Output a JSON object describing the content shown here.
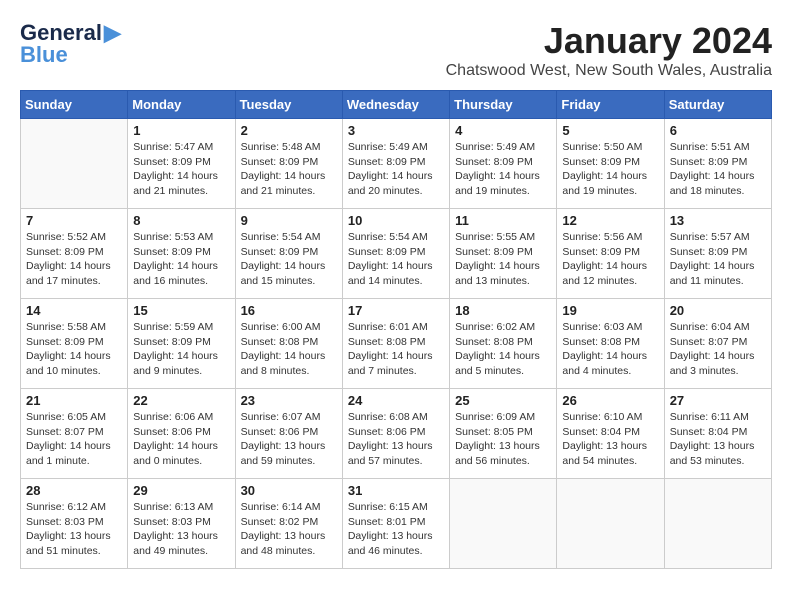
{
  "logo": {
    "general": "General",
    "blue": "Blue",
    "bird_unicode": "🐦"
  },
  "title": "January 2024",
  "subtitle": "Chatswood West, New South Wales, Australia",
  "days_header": [
    "Sunday",
    "Monday",
    "Tuesday",
    "Wednesday",
    "Thursday",
    "Friday",
    "Saturday"
  ],
  "weeks": [
    [
      {
        "num": "",
        "info": ""
      },
      {
        "num": "1",
        "info": "Sunrise: 5:47 AM\nSunset: 8:09 PM\nDaylight: 14 hours\nand 21 minutes."
      },
      {
        "num": "2",
        "info": "Sunrise: 5:48 AM\nSunset: 8:09 PM\nDaylight: 14 hours\nand 21 minutes."
      },
      {
        "num": "3",
        "info": "Sunrise: 5:49 AM\nSunset: 8:09 PM\nDaylight: 14 hours\nand 20 minutes."
      },
      {
        "num": "4",
        "info": "Sunrise: 5:49 AM\nSunset: 8:09 PM\nDaylight: 14 hours\nand 19 minutes."
      },
      {
        "num": "5",
        "info": "Sunrise: 5:50 AM\nSunset: 8:09 PM\nDaylight: 14 hours\nand 19 minutes."
      },
      {
        "num": "6",
        "info": "Sunrise: 5:51 AM\nSunset: 8:09 PM\nDaylight: 14 hours\nand 18 minutes."
      }
    ],
    [
      {
        "num": "7",
        "info": "Sunrise: 5:52 AM\nSunset: 8:09 PM\nDaylight: 14 hours\nand 17 minutes."
      },
      {
        "num": "8",
        "info": "Sunrise: 5:53 AM\nSunset: 8:09 PM\nDaylight: 14 hours\nand 16 minutes."
      },
      {
        "num": "9",
        "info": "Sunrise: 5:54 AM\nSunset: 8:09 PM\nDaylight: 14 hours\nand 15 minutes."
      },
      {
        "num": "10",
        "info": "Sunrise: 5:54 AM\nSunset: 8:09 PM\nDaylight: 14 hours\nand 14 minutes."
      },
      {
        "num": "11",
        "info": "Sunrise: 5:55 AM\nSunset: 8:09 PM\nDaylight: 14 hours\nand 13 minutes."
      },
      {
        "num": "12",
        "info": "Sunrise: 5:56 AM\nSunset: 8:09 PM\nDaylight: 14 hours\nand 12 minutes."
      },
      {
        "num": "13",
        "info": "Sunrise: 5:57 AM\nSunset: 8:09 PM\nDaylight: 14 hours\nand 11 minutes."
      }
    ],
    [
      {
        "num": "14",
        "info": "Sunrise: 5:58 AM\nSunset: 8:09 PM\nDaylight: 14 hours\nand 10 minutes."
      },
      {
        "num": "15",
        "info": "Sunrise: 5:59 AM\nSunset: 8:09 PM\nDaylight: 14 hours\nand 9 minutes."
      },
      {
        "num": "16",
        "info": "Sunrise: 6:00 AM\nSunset: 8:08 PM\nDaylight: 14 hours\nand 8 minutes."
      },
      {
        "num": "17",
        "info": "Sunrise: 6:01 AM\nSunset: 8:08 PM\nDaylight: 14 hours\nand 7 minutes."
      },
      {
        "num": "18",
        "info": "Sunrise: 6:02 AM\nSunset: 8:08 PM\nDaylight: 14 hours\nand 5 minutes."
      },
      {
        "num": "19",
        "info": "Sunrise: 6:03 AM\nSunset: 8:08 PM\nDaylight: 14 hours\nand 4 minutes."
      },
      {
        "num": "20",
        "info": "Sunrise: 6:04 AM\nSunset: 8:07 PM\nDaylight: 14 hours\nand 3 minutes."
      }
    ],
    [
      {
        "num": "21",
        "info": "Sunrise: 6:05 AM\nSunset: 8:07 PM\nDaylight: 14 hours\nand 1 minute."
      },
      {
        "num": "22",
        "info": "Sunrise: 6:06 AM\nSunset: 8:06 PM\nDaylight: 14 hours\nand 0 minutes."
      },
      {
        "num": "23",
        "info": "Sunrise: 6:07 AM\nSunset: 8:06 PM\nDaylight: 13 hours\nand 59 minutes."
      },
      {
        "num": "24",
        "info": "Sunrise: 6:08 AM\nSunset: 8:06 PM\nDaylight: 13 hours\nand 57 minutes."
      },
      {
        "num": "25",
        "info": "Sunrise: 6:09 AM\nSunset: 8:05 PM\nDaylight: 13 hours\nand 56 minutes."
      },
      {
        "num": "26",
        "info": "Sunrise: 6:10 AM\nSunset: 8:04 PM\nDaylight: 13 hours\nand 54 minutes."
      },
      {
        "num": "27",
        "info": "Sunrise: 6:11 AM\nSunset: 8:04 PM\nDaylight: 13 hours\nand 53 minutes."
      }
    ],
    [
      {
        "num": "28",
        "info": "Sunrise: 6:12 AM\nSunset: 8:03 PM\nDaylight: 13 hours\nand 51 minutes."
      },
      {
        "num": "29",
        "info": "Sunrise: 6:13 AM\nSunset: 8:03 PM\nDaylight: 13 hours\nand 49 minutes."
      },
      {
        "num": "30",
        "info": "Sunrise: 6:14 AM\nSunset: 8:02 PM\nDaylight: 13 hours\nand 48 minutes."
      },
      {
        "num": "31",
        "info": "Sunrise: 6:15 AM\nSunset: 8:01 PM\nDaylight: 13 hours\nand 46 minutes."
      },
      {
        "num": "",
        "info": ""
      },
      {
        "num": "",
        "info": ""
      },
      {
        "num": "",
        "info": ""
      }
    ]
  ]
}
